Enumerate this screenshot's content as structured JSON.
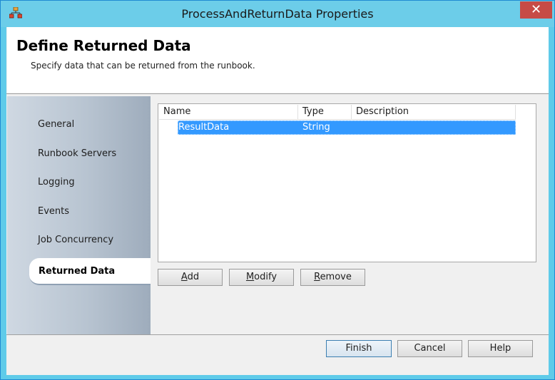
{
  "window": {
    "title": "ProcessAndReturnData Properties",
    "close_glyph": "✕"
  },
  "header": {
    "title": "Define Returned Data",
    "subtitle": "Specify data that can be returned from the runbook."
  },
  "nav": {
    "items": [
      "General",
      "Runbook Servers",
      "Logging",
      "Events",
      "Job Concurrency"
    ],
    "active": "Returned Data"
  },
  "table": {
    "columns": [
      "Name",
      "Type",
      "Description"
    ],
    "rows": [
      {
        "name": "ResultData",
        "type": "String",
        "description": ""
      }
    ]
  },
  "actions": {
    "add": {
      "pre": "",
      "key": "A",
      "post": "dd"
    },
    "modify": {
      "pre": "",
      "key": "M",
      "post": "odify"
    },
    "remove": {
      "pre": "",
      "key": "R",
      "post": "emove"
    }
  },
  "footer": {
    "finish": "Finish",
    "cancel": "Cancel",
    "help": "Help"
  },
  "colors": {
    "titlebar": "#6ccde9",
    "selection": "#3399ff",
    "close": "#c74b46"
  },
  "icons": {
    "app": "runbook-activity-icon",
    "close": "close-icon"
  }
}
